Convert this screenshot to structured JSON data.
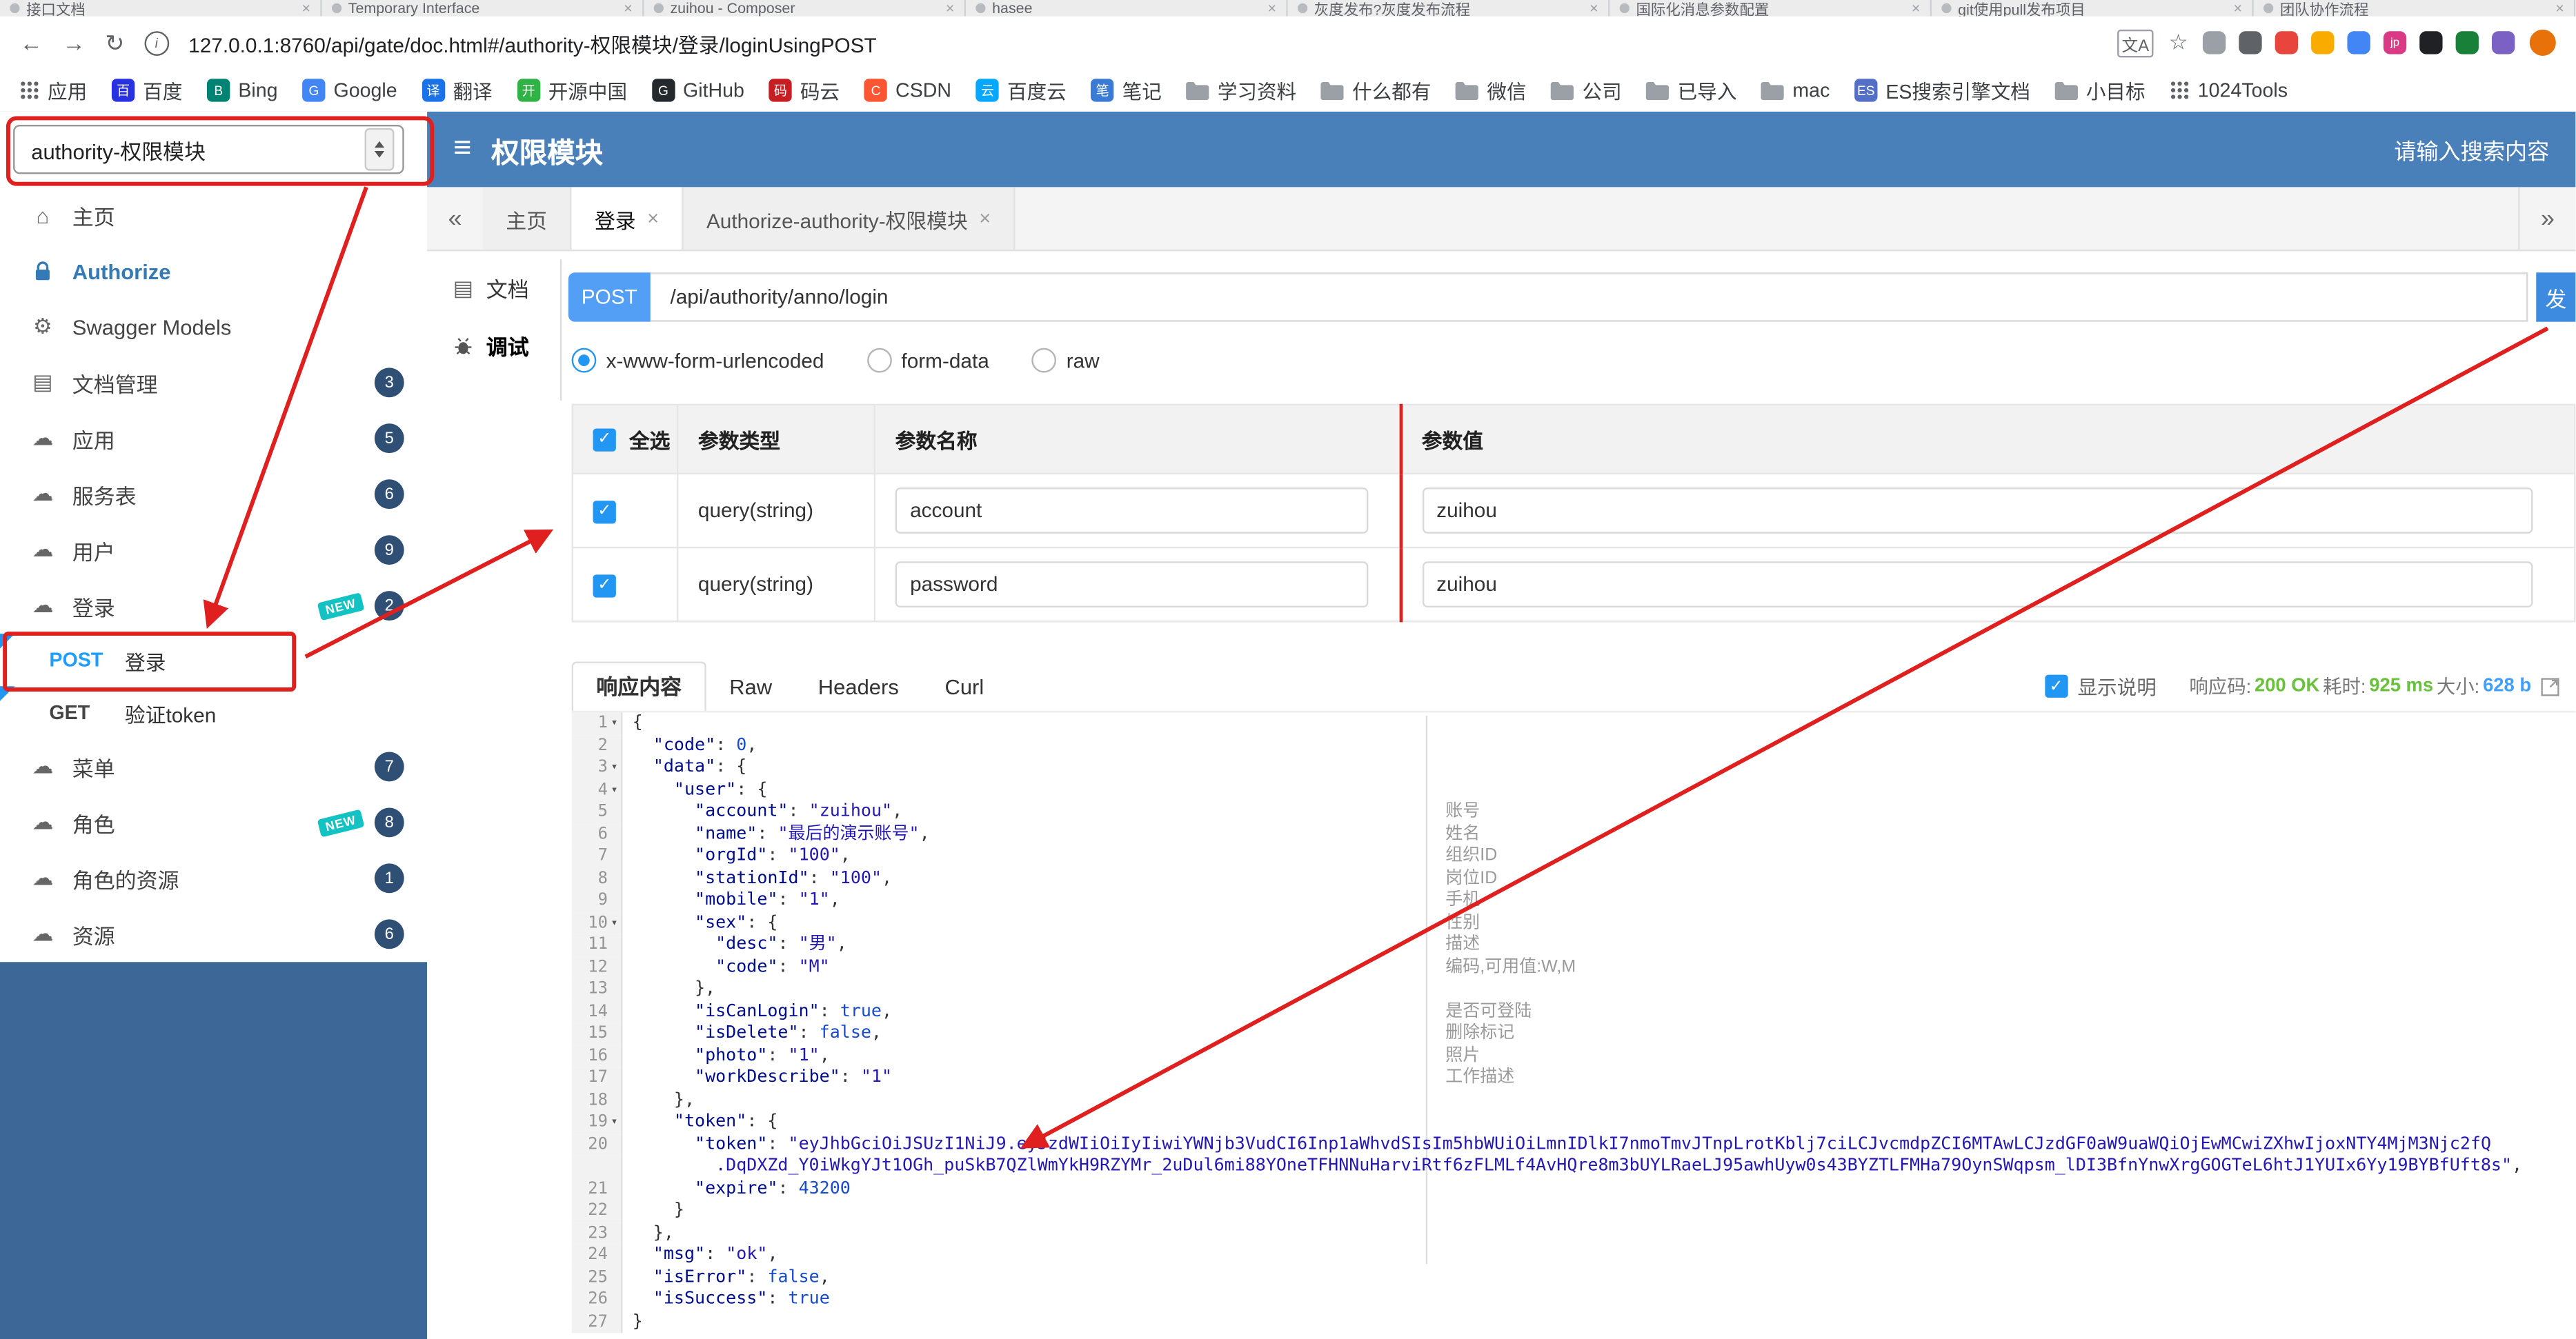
{
  "colors": {
    "header_blue": "#4a80b9",
    "sidebar_fill": "#3d6796",
    "badge": "#2f4f75",
    "new_tag": "#13c2c2",
    "post_text": "#1e9fff",
    "post_badge": "#549ff6",
    "send_button": "#3d8be0",
    "link": "#337ab7",
    "success": "#67c23a",
    "info_blue": "#409eff",
    "annotation_red": "#e01f1f"
  },
  "browser": {
    "tabs": [
      {
        "title": "接口文档"
      },
      {
        "title": "Temporary Interface"
      },
      {
        "title": "zuihou - Composer"
      },
      {
        "title": "hasee"
      },
      {
        "title": "灰度发布?灰度发布流程"
      },
      {
        "title": "国际化消息参数配置"
      },
      {
        "title": "git使用pull发布项目"
      },
      {
        "title": "团队协作流程"
      }
    ],
    "address": {
      "url": "127.0.0.1:8760/api/gate/doc.html#/authority-权限模块/登录/loginUsingPOST"
    },
    "extensions": [
      {
        "color": "#9aa0a6"
      },
      {
        "color": "#5f6368"
      },
      {
        "color": "#e8453c"
      },
      {
        "color": "#f9ab00"
      },
      {
        "color": "#4285f4"
      },
      {
        "color": "#d93a86",
        "glyph": "jp"
      },
      {
        "color": "#202124"
      },
      {
        "color": "#188038"
      },
      {
        "color": "#7b61c4"
      }
    ],
    "bookmarks": [
      {
        "label": "应用",
        "kind": "apps"
      },
      {
        "label": "百度",
        "kind": "site",
        "color": "#2932e1",
        "glyph": "百"
      },
      {
        "label": "Bing",
        "kind": "site",
        "color": "#008373",
        "glyph": "B"
      },
      {
        "label": "Google",
        "kind": "site",
        "color": "#4285f4",
        "glyph": "G"
      },
      {
        "label": "翻译",
        "kind": "site",
        "color": "#1a73e8",
        "glyph": "译"
      },
      {
        "label": "开源中国",
        "kind": "site",
        "color": "#2fb344",
        "glyph": "开"
      },
      {
        "label": "GitHub",
        "kind": "site",
        "color": "#24292e",
        "glyph": "G"
      },
      {
        "label": "码云",
        "kind": "site",
        "color": "#c71d23",
        "glyph": "码"
      },
      {
        "label": "CSDN",
        "kind": "site",
        "color": "#fc5531",
        "glyph": "C"
      },
      {
        "label": "百度云",
        "kind": "site",
        "color": "#06a7ff",
        "glyph": "云"
      },
      {
        "label": "笔记",
        "kind": "site",
        "color": "#3a7bd5",
        "glyph": "笔"
      },
      {
        "label": "学习资料",
        "kind": "folder"
      },
      {
        "label": "什么都有",
        "kind": "folder"
      },
      {
        "label": "微信",
        "kind": "folder"
      },
      {
        "label": "公司",
        "kind": "folder"
      },
      {
        "label": "已导入",
        "kind": "folder"
      },
      {
        "label": "mac",
        "kind": "folder"
      },
      {
        "label": "ES搜索引擎文档",
        "kind": "site",
        "color": "#5470c6",
        "glyph": "ES"
      },
      {
        "label": "小目标",
        "kind": "folder"
      },
      {
        "label": "1024Tools",
        "kind": "apps"
      }
    ]
  },
  "header": {
    "group_select": "authority-权限模块",
    "title": "权限模块",
    "search_placeholder": "请输入搜索内容"
  },
  "sidebar": {
    "items": [
      {
        "id": "home",
        "label": "主页",
        "icon": "home",
        "kind": "link"
      },
      {
        "id": "authorize",
        "label": "Authorize",
        "icon": "lock",
        "kind": "link",
        "accent": true
      },
      {
        "id": "swagger-models",
        "label": "Swagger Models",
        "icon": "gear",
        "kind": "link"
      },
      {
        "id": "doc-management",
        "label": "文档管理",
        "icon": "doc",
        "kind": "link",
        "badge": "3"
      },
      {
        "id": "application",
        "label": "应用",
        "icon": "cloud",
        "kind": "link",
        "badge": "5"
      },
      {
        "id": "service-table",
        "label": "服务表",
        "icon": "cloud",
        "kind": "link",
        "badge": "6"
      },
      {
        "id": "user",
        "label": "用户",
        "icon": "cloud",
        "kind": "link",
        "badge": "9"
      },
      {
        "id": "login",
        "label": "登录",
        "icon": "cloud",
        "kind": "link",
        "badge": "2",
        "new": true
      },
      {
        "id": "login-post",
        "label": "登录",
        "kind": "endpoint",
        "method": "POST"
      },
      {
        "id": "verify-token-get",
        "label": "验证token",
        "kind": "endpoint",
        "method": "GET"
      },
      {
        "id": "menu",
        "label": "菜单",
        "icon": "cloud",
        "kind": "link",
        "badge": "7"
      },
      {
        "id": "role",
        "label": "角色",
        "icon": "cloud",
        "kind": "link",
        "badge": "8",
        "new": true
      },
      {
        "id": "role-resource",
        "label": "角色的资源",
        "icon": "cloud",
        "kind": "link",
        "badge": "1"
      },
      {
        "id": "resource",
        "label": "资源",
        "icon": "cloud",
        "kind": "link",
        "badge": "6"
      }
    ]
  },
  "workspace": {
    "nav": {
      "prev": "«",
      "next": "»",
      "tabs": [
        {
          "id": "home",
          "label": "主页"
        },
        {
          "id": "login",
          "label": "登录",
          "closable": true,
          "active": true
        },
        {
          "id": "authorize",
          "label": "Authorize-authority-权限模块",
          "closable": true
        }
      ]
    },
    "side_tabs": [
      {
        "id": "document",
        "label": "文档",
        "icon": "doc"
      },
      {
        "id": "debug",
        "label": "调试",
        "icon": "bug",
        "active": true
      }
    ],
    "request": {
      "method": "POST",
      "url": "/api/authority/anno/login",
      "send_label": "发"
    },
    "content_types": [
      {
        "label": "x-www-form-urlencoded",
        "selected": true
      },
      {
        "label": "form-data"
      },
      {
        "label": "raw"
      }
    ],
    "params": {
      "select_all_label": "全选",
      "columns": [
        "参数类型",
        "参数名称",
        "参数值"
      ],
      "rows": [
        {
          "checked": true,
          "type": "query(string)",
          "name": "account",
          "value": "zuihou"
        },
        {
          "checked": true,
          "type": "query(string)",
          "name": "password",
          "value": "zuihou"
        }
      ]
    },
    "response": {
      "tabs": [
        {
          "id": "body",
          "label": "响应内容",
          "active": true
        },
        {
          "id": "raw",
          "label": "Raw"
        },
        {
          "id": "headers",
          "label": "Headers"
        },
        {
          "id": "curl",
          "label": "Curl"
        }
      ],
      "show_desc_label": "显示说明",
      "show_desc_checked": true,
      "status": [
        {
          "label": "响应码:",
          "value": "200 OK",
          "tone": "success"
        },
        {
          "label": "耗时:",
          "value": "925 ms",
          "tone": "success"
        },
        {
          "label": "大小:",
          "value": "628 b",
          "tone": "info"
        }
      ]
    },
    "code": {
      "lines": [
        {
          "n": 1,
          "t": "{",
          "fold": true
        },
        {
          "n": 2,
          "t": "  \"code\": 0,"
        },
        {
          "n": 3,
          "t": "  \"data\": {",
          "fold": true
        },
        {
          "n": 4,
          "t": "    \"user\": {",
          "fold": true
        },
        {
          "n": 5,
          "t": "      \"account\": \"zuihou\",",
          "note": "账号"
        },
        {
          "n": 6,
          "t": "      \"name\": \"最后的演示账号\",",
          "note": "姓名"
        },
        {
          "n": 7,
          "t": "      \"orgId\": \"100\",",
          "note": "组织ID"
        },
        {
          "n": 8,
          "t": "      \"stationId\": \"100\",",
          "note": "岗位ID"
        },
        {
          "n": 9,
          "t": "      \"mobile\": \"1\",",
          "note": "手机"
        },
        {
          "n": 10,
          "t": "      \"sex\": {",
          "fold": true,
          "note": "性别"
        },
        {
          "n": 11,
          "t": "        \"desc\": \"男\",",
          "note": "描述"
        },
        {
          "n": 12,
          "t": "        \"code\": \"M\"",
          "note": "编码,可用值:W,M"
        },
        {
          "n": 13,
          "t": "      },"
        },
        {
          "n": 14,
          "t": "      \"isCanLogin\": true,",
          "note": "是否可登陆"
        },
        {
          "n": 15,
          "t": "      \"isDelete\": false,",
          "note": "删除标记"
        },
        {
          "n": 16,
          "t": "      \"photo\": \"1\",",
          "note": "照片"
        },
        {
          "n": 17,
          "t": "      \"workDescribe\": \"1\"",
          "note": "工作描述"
        },
        {
          "n": 18,
          "t": "    },"
        },
        {
          "n": 19,
          "t": "    \"token\": {",
          "fold": true
        },
        {
          "n": 20,
          "t": "      \"token\": \"eyJhbGciOiJSUzI1NiJ9.eyJzdWIiOiIyIiwiYWNjb3VudCI6Inp1aWhvdSIsIm5hbWUiOiLmnIDlkI7nmoTmvJTnpLrotKblj7ciLCJvcmdpZCI6MTAwLCJzdGF0aW9uaWQiOjEwMCwiZXhwIjoxNTY4MjM3Njc2fQ"
        },
        {
          "n": "",
          "t": "        .DqDXZd_Y0iWkgYJt1OGh_puSkB7QZlWmYkH9RZYMr_2uDul6mi88YOneTFHNNuHarviRtf6zFLMLf4AvHQre8m3bUYLRaeLJ95awhUyw0s43BYZTLFMHa79OynSWqpsm_lDI3BfnYnwXrgGOGTeL6htJ1YUIx6Yy19BYBfUft8s\",",
          "cont": true
        },
        {
          "n": 21,
          "t": "      \"expire\": 43200"
        },
        {
          "n": 22,
          "t": "    }"
        },
        {
          "n": 23,
          "t": "  },"
        },
        {
          "n": 24,
          "t": "  \"msg\": \"ok\","
        },
        {
          "n": 25,
          "t": "  \"isError\": false,"
        },
        {
          "n": 26,
          "t": "  \"isSuccess\": true"
        },
        {
          "n": 27,
          "t": "}"
        }
      ]
    }
  },
  "annotation": {
    "color": "#e01f1f"
  }
}
